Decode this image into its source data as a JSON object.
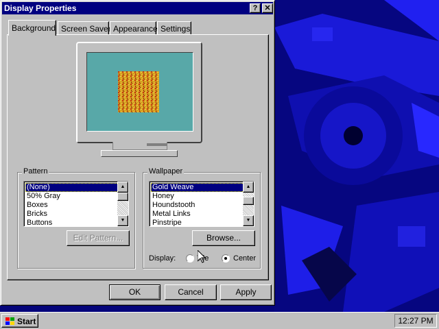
{
  "window": {
    "title": "Display Properties",
    "help_button": "?",
    "close_button": "✕"
  },
  "tabs": [
    {
      "label": "Background",
      "active": true
    },
    {
      "label": "Screen Saver",
      "active": false
    },
    {
      "label": "Appearance",
      "active": false
    },
    {
      "label": "Settings",
      "active": false
    }
  ],
  "pattern": {
    "label": "Pattern",
    "items": [
      "(None)",
      "50% Gray",
      "Boxes",
      "Bricks",
      "Buttons"
    ],
    "selected": "(None)",
    "edit_button": "Edit Pattern..."
  },
  "wallpaper": {
    "label": "Wallpaper",
    "items": [
      "Gold Weave",
      "Honey",
      "Houndstooth",
      "Metal Links",
      "Pinstripe"
    ],
    "selected": "Gold Weave",
    "browse_button": "Browse...",
    "display_label": "Display:",
    "display_options": [
      {
        "label": "Tile",
        "checked": false
      },
      {
        "label": "Center",
        "checked": true
      }
    ]
  },
  "buttons": {
    "ok": "OK",
    "cancel": "Cancel",
    "apply": "Apply"
  },
  "taskbar": {
    "start_label": "Start",
    "clock": "12:27 PM"
  },
  "colors": {
    "title_bar": "#000080",
    "desktop": "#05057a",
    "preview_screen": "#58a8a8",
    "face": "#c0c0c0"
  }
}
